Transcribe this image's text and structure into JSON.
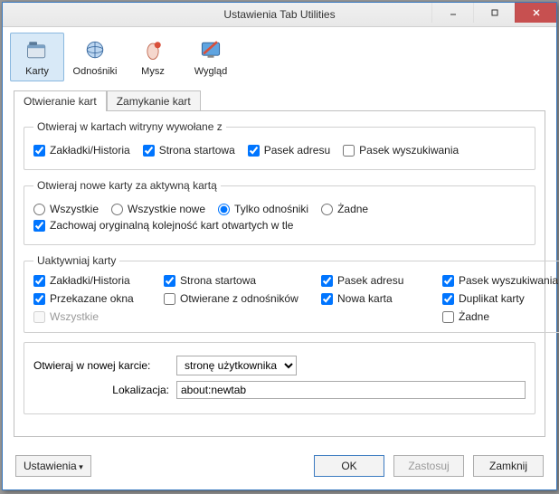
{
  "title": "Ustawienia Tab Utilities",
  "toolbar": {
    "tabs": {
      "label": "Karty",
      "selected": true
    },
    "links": {
      "label": "Odnośniki"
    },
    "mouse": {
      "label": "Mysz"
    },
    "appearance": {
      "label": "Wygląd"
    }
  },
  "tabs": {
    "opening": "Otwieranie kart",
    "closing": "Zamykanie kart"
  },
  "group1": {
    "legend": "Otwieraj w kartach witryny wywołane z",
    "bookmarks": "Zakładki/Historia",
    "homepage": "Strona startowa",
    "urlbar": "Pasek adresu",
    "searchbar": "Pasek wyszukiwania"
  },
  "group2": {
    "legend": "Otwieraj nowe karty za aktywną kartą",
    "all": "Wszystkie",
    "allnew": "Wszystkie nowe",
    "linksonly": "Tylko odnośniki",
    "none": "Żadne",
    "preserve": "Zachowaj oryginalną kolejność kart otwartych w tle"
  },
  "group3": {
    "legend": "Uaktywniaj karty",
    "bookmarks": "Zakładki/Historia",
    "homepage": "Strona startowa",
    "urlbar": "Pasek adresu",
    "searchbar": "Pasek wyszukiwania",
    "diverted": "Przekazane okna",
    "fromlinks": "Otwierane z odnośników",
    "newtab": "Nowa karta",
    "duplicate": "Duplikat karty",
    "all": "Wszystkie",
    "none": "Żadne"
  },
  "group4": {
    "openin": "Otwieraj w nowej karcie:",
    "selected": "stronę użytkownika",
    "location_label": "Lokalizacja:",
    "location_value": "about:newtab"
  },
  "footer": {
    "settings": "Ustawienia",
    "ok": "OK",
    "apply": "Zastosuj",
    "close": "Zamknij"
  }
}
